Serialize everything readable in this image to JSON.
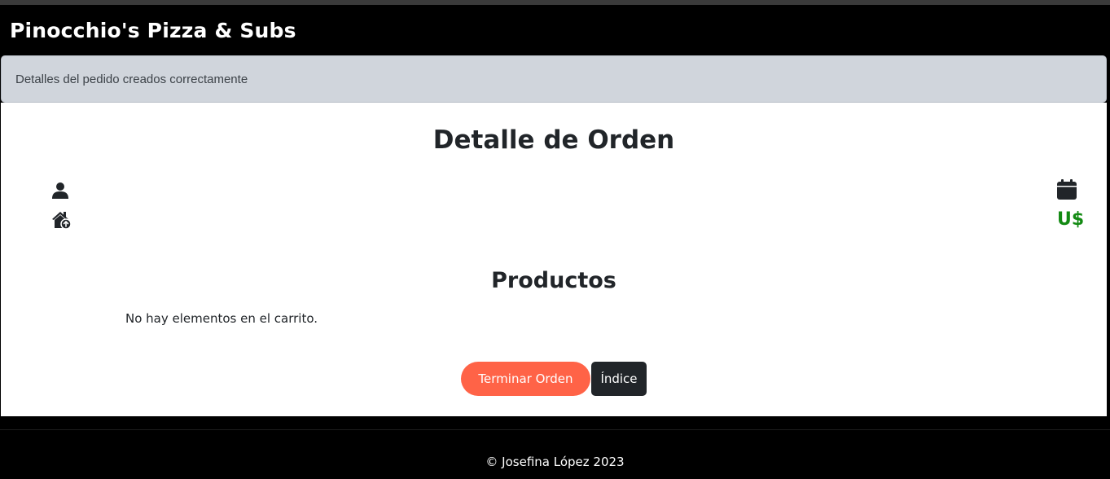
{
  "navbar": {
    "brand": "Pinocchio's Pizza & Subs"
  },
  "alert": {
    "message": "Detalles del pedido creados correctamente"
  },
  "order": {
    "title": "Detalle de Orden",
    "currency_label": "U$",
    "icons": {
      "customer": "user-icon",
      "address": "house-upload-icon",
      "date": "calendar-icon"
    }
  },
  "products": {
    "title": "Productos",
    "empty_message": "No hay elementos en el carrito."
  },
  "actions": {
    "finish_label": "Terminar Orden",
    "index_label": "Índice"
  },
  "footer": {
    "text": "© Josefina López 2023"
  },
  "colors": {
    "navbar_bg": "#000000",
    "alert_bg": "#d0d5dc",
    "finish_button": "#ff6347",
    "index_button": "#212529",
    "currency": "#138a13"
  }
}
